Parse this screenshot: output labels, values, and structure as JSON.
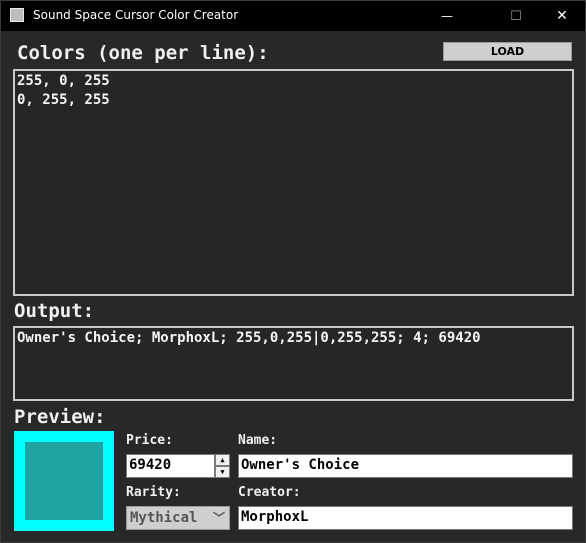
{
  "window": {
    "title": "Sound Space Cursor Color Creator",
    "minimize_glyph": "—",
    "maximize_glyph": "☐",
    "close_glyph": "✕"
  },
  "colors_section": {
    "label": "Colors (one per line):",
    "value": "255, 0, 255\n0, 255, 255"
  },
  "toolbar": {
    "load_label": "LOAD"
  },
  "output_section": {
    "label": "Output:",
    "value": "Owner's Choice; MorphoxL; 255,0,255|0,255,255; 4; 69420"
  },
  "preview_section": {
    "label": "Preview:",
    "border_color": "#00ffff",
    "fill_color": "#1fa3a3"
  },
  "price": {
    "label": "Price:",
    "value": "69420"
  },
  "name": {
    "label": "Name:",
    "value": "Owner's Choice"
  },
  "rarity": {
    "label": "Rarity:",
    "value": "Mythical"
  },
  "creator": {
    "label": "Creator:",
    "value": "MorphoxL"
  }
}
